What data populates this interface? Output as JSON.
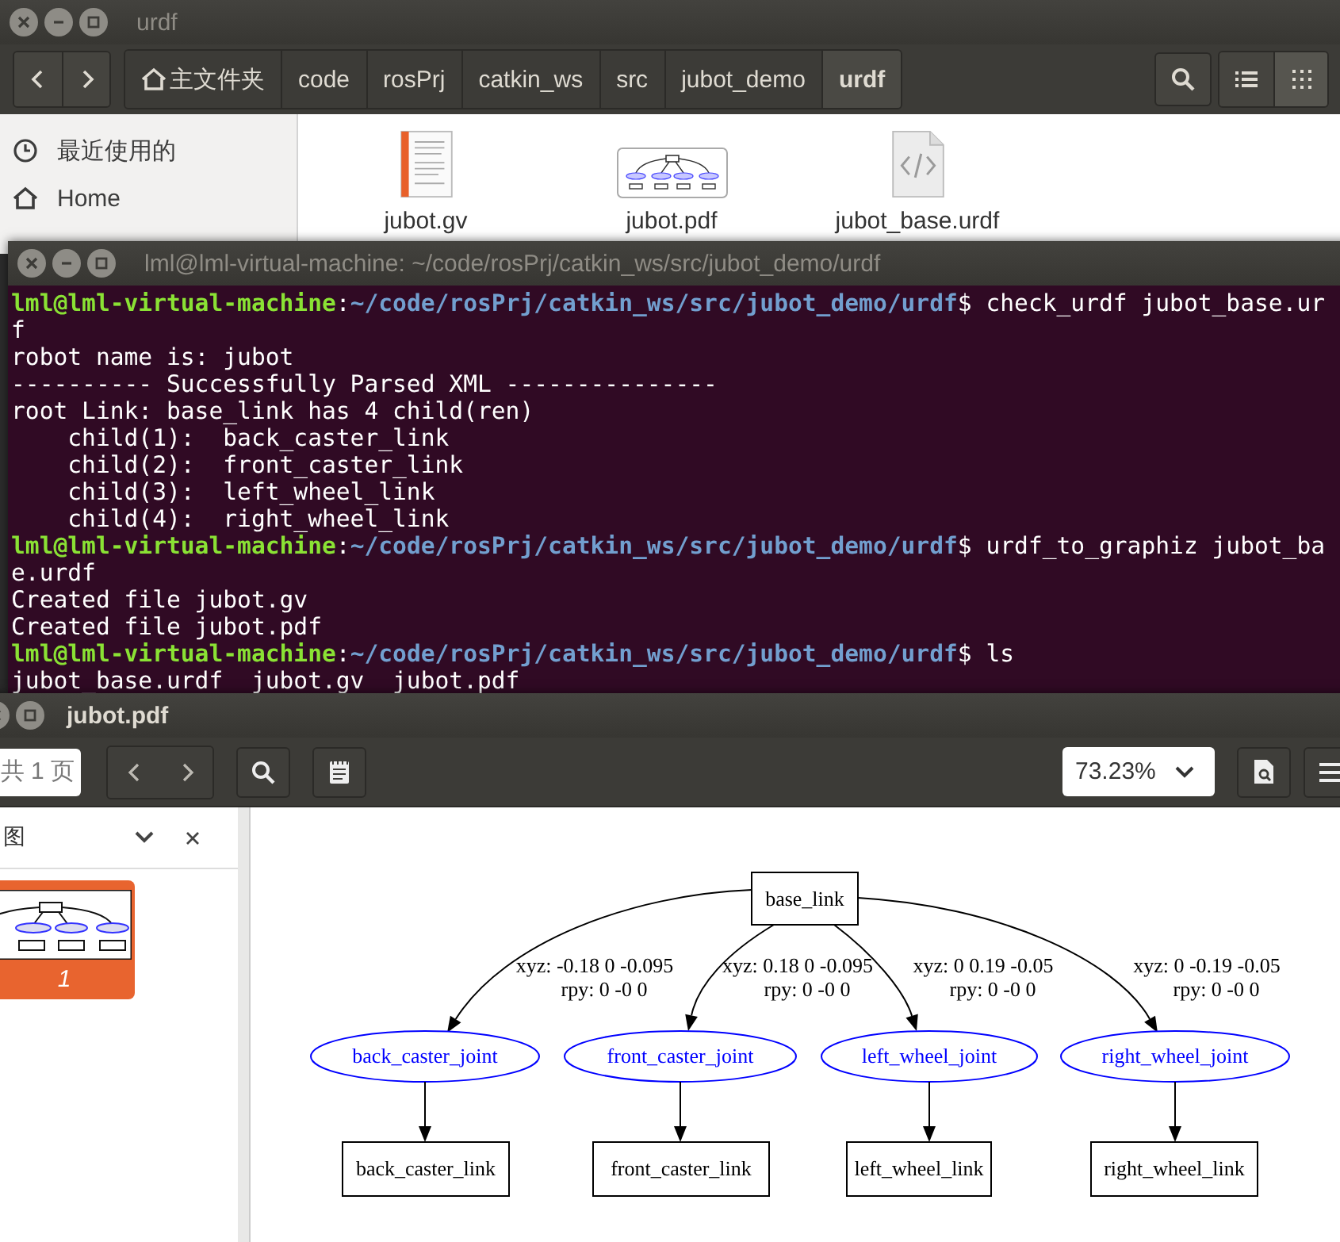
{
  "file_manager": {
    "title": "urdf",
    "path": [
      {
        "label": "主文件夹",
        "kind": "home",
        "selected": false
      },
      {
        "label": "code",
        "selected": false
      },
      {
        "label": "rosPrj",
        "selected": false
      },
      {
        "label": "catkin_ws",
        "selected": false
      },
      {
        "label": "src",
        "selected": false
      },
      {
        "label": "jubot_demo",
        "selected": false
      },
      {
        "label": "urdf",
        "selected": true
      }
    ],
    "view_buttons": [
      {
        "kind": "list",
        "selected": false
      },
      {
        "kind": "grid",
        "selected": true
      }
    ],
    "sidebar": [
      {
        "label": "最近使用的",
        "kind": "recent"
      },
      {
        "label": "Home",
        "kind": "home"
      }
    ],
    "files": [
      {
        "name": "jubot.gv",
        "kind": "text"
      },
      {
        "name": "jubot.pdf",
        "kind": "pdf"
      },
      {
        "name": "jubot_base.urdf",
        "kind": "code"
      }
    ]
  },
  "terminal": {
    "title": "lml@lml-virtual-machine: ~/code/rosPrj/catkin_ws/src/jubot_demo/urdf",
    "lines": [
      {
        "kind": "prompt",
        "user": "lml@lml-virtual-machine",
        "sep": ":",
        "path": "~/code/rosPrj/catkin_ws/src/jubot_demo/urdf",
        "command": "$ check_urdf jubot_base.ur"
      },
      {
        "kind": "output",
        "text": "f"
      },
      {
        "kind": "output",
        "text": "robot name is: jubot"
      },
      {
        "kind": "output",
        "text": "---------- Successfully Parsed XML ---------------"
      },
      {
        "kind": "output",
        "text": "root Link: base_link has 4 child(ren)"
      },
      {
        "kind": "output",
        "text": "    child(1):  back_caster_link"
      },
      {
        "kind": "output",
        "text": "    child(2):  front_caster_link"
      },
      {
        "kind": "output",
        "text": "    child(3):  left_wheel_link"
      },
      {
        "kind": "output",
        "text": "    child(4):  right_wheel_link"
      },
      {
        "kind": "prompt",
        "user": "lml@lml-virtual-machine",
        "sep": ":",
        "path": "~/code/rosPrj/catkin_ws/src/jubot_demo/urdf",
        "command": "$ urdf_to_graphiz jubot_ba"
      },
      {
        "kind": "output",
        "text": "e.urdf"
      },
      {
        "kind": "output",
        "text": "Created file jubot.gv"
      },
      {
        "kind": "output",
        "text": "Created file jubot.pdf"
      },
      {
        "kind": "prompt",
        "user": "lml@lml-virtual-machine",
        "sep": ":",
        "path": "~/code/rosPrj/catkin_ws/src/jubot_demo/urdf",
        "command": "$ ls"
      },
      {
        "kind": "output",
        "text": "jubot_base.urdf  jubot.gv  jubot.pdf"
      }
    ]
  },
  "pdf_viewer": {
    "title": "jubot.pdf",
    "page_field": "共 1 页",
    "zoom": "73.23%",
    "sidebar": {
      "title": "图",
      "thumbnails": [
        {
          "label": "1",
          "selected": true
        }
      ]
    },
    "graph": {
      "root": "base_link",
      "joints": [
        {
          "name": "back_caster_joint",
          "xyz": "xyz: -0.18 0 -0.095",
          "rpy": "rpy: 0 -0 0",
          "child": "back_caster_link"
        },
        {
          "name": "front_caster_joint",
          "xyz": "xyz: 0.18 0 -0.095",
          "rpy": "rpy: 0 -0 0",
          "child": "front_caster_link"
        },
        {
          "name": "left_wheel_joint",
          "xyz": "xyz: 0 0.19 -0.05",
          "rpy": "rpy: 0 -0 0",
          "child": "left_wheel_link"
        },
        {
          "name": "right_wheel_joint",
          "xyz": "xyz: 0 -0.19 -0.05",
          "rpy": "rpy: 0 -0 0",
          "child": "right_wheel_link"
        }
      ]
    }
  }
}
